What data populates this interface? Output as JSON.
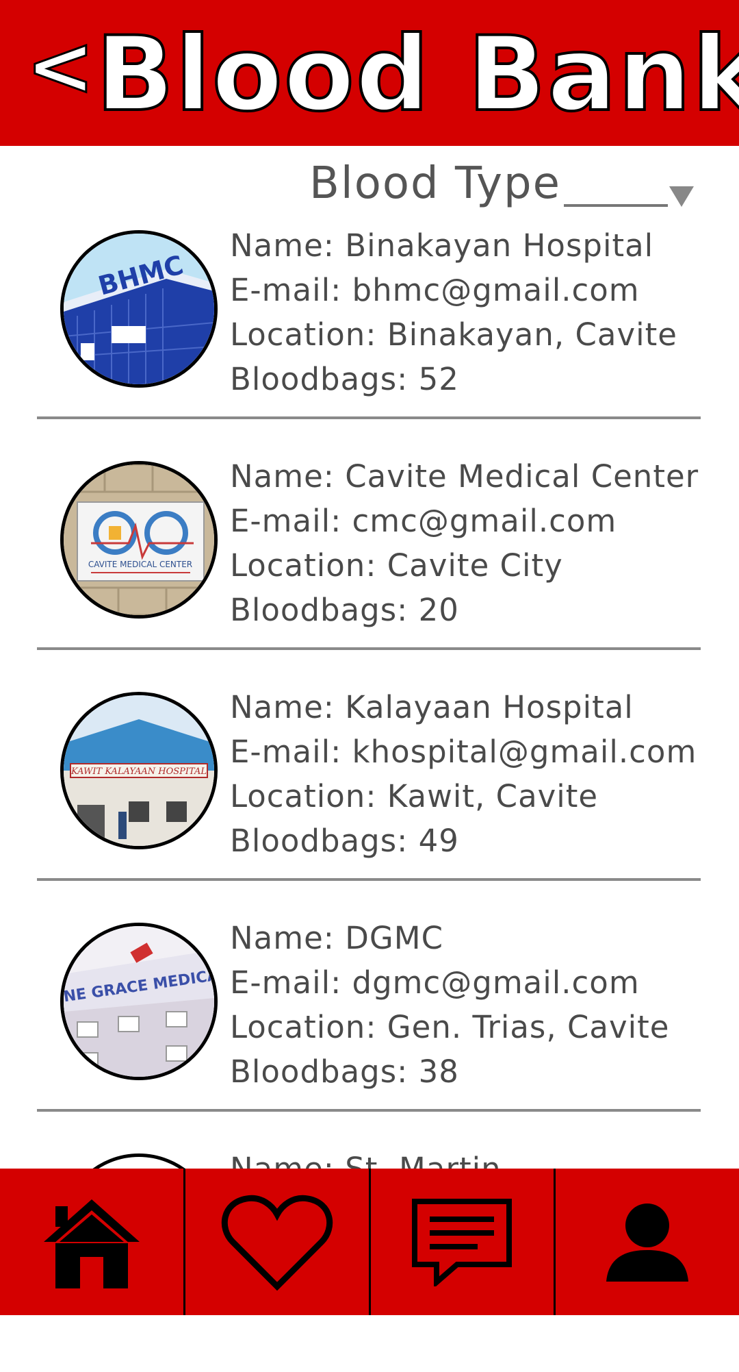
{
  "header": {
    "back_label": "<",
    "title": "Blood Bank"
  },
  "filter": {
    "label": "Blood Type",
    "value": ""
  },
  "hospitals": [
    {
      "name": "Name: Binakayan Hospital",
      "email": "E-mail: bhmc@gmail.com",
      "location": "Location: Binakayan, Cavite",
      "bloodbags": "Bloodbags: 52",
      "logo_text": "BHMC"
    },
    {
      "name": "Name: Cavite Medical Center",
      "email": "E-mail: cmc@gmail.com",
      "location": "Location: Cavite City",
      "bloodbags": "Bloodbags: 20",
      "logo_text": "CAVITE MEDICAL CENTER"
    },
    {
      "name": "Name: Kalayaan Hospital",
      "email": "E-mail: khospital@gmail.com",
      "location": "Location: Kawit, Cavite",
      "bloodbags": "Bloodbags: 49",
      "logo_text": "KAWIT KALAYAAN HOSPITAL"
    },
    {
      "name": "Name: DGMC",
      "email": "E-mail: dgmc@gmail.com",
      "location": "Location: Gen. Trias, Cavite",
      "bloodbags": "Bloodbags: 38",
      "logo_text": "INE GRACE MEDICA"
    },
    {
      "name": "Name: St. Martin"
    }
  ],
  "nav": {
    "items": [
      {
        "icon": "home-icon"
      },
      {
        "icon": "heart-icon"
      },
      {
        "icon": "chat-icon"
      },
      {
        "icon": "profile-icon"
      }
    ]
  },
  "colors": {
    "brand_red": "#d40000",
    "text_gray": "#4a4a4a"
  }
}
